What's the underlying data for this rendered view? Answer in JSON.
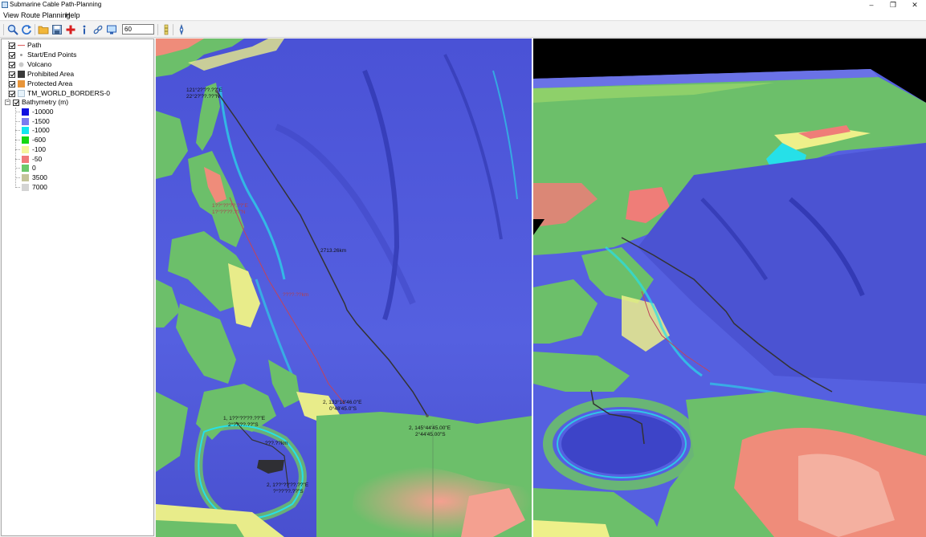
{
  "window": {
    "title": "Submarine Cable Path-Planning",
    "minimize_glyph": "–",
    "maximize_glyph": "❐",
    "close_glyph": "✕"
  },
  "menu": {
    "items": [
      "View",
      "Route Planning",
      "Help"
    ]
  },
  "toolbar": {
    "zoom_value": "60",
    "icons": [
      "zoom-icon",
      "refresh-icon",
      "open-folder-icon",
      "save-icon",
      "add-point-icon",
      "info-icon",
      "link-icon",
      "screen-icon",
      "scale-bar-icon",
      "compass-icon"
    ]
  },
  "layers": {
    "items": [
      {
        "label": "Path",
        "symbol": "line",
        "color": "#e06b6b"
      },
      {
        "label": "Start/End Points",
        "symbol": "dot",
        "color": "#9a9a9a"
      },
      {
        "label": "Volcano",
        "symbol": "circle",
        "color": "#b9b9b9"
      },
      {
        "label": "Prohibited Area",
        "symbol": "square",
        "color": "#3a3a3a"
      },
      {
        "label": "Protected Area",
        "symbol": "square",
        "color": "#e8953a"
      },
      {
        "label": "TM_WORLD_BORDERS-0",
        "symbol": "square",
        "color": "#e6f2fa"
      }
    ],
    "bathymetry": {
      "label": "Bathymetry (m)",
      "legend": [
        {
          "label": "-10000",
          "color": "#1010e0"
        },
        {
          "label": "-1500",
          "color": "#7b7bf0"
        },
        {
          "label": "-1000",
          "color": "#12e6ef"
        },
        {
          "label": "-600",
          "color": "#14d814"
        },
        {
          "label": "-100",
          "color": "#f5f59c"
        },
        {
          "label": "-50",
          "color": "#f07a7a"
        },
        {
          "label": "0",
          "color": "#6bc96b"
        },
        {
          "label": "3500",
          "color": "#c4c49b"
        },
        {
          "label": "7000",
          "color": "#d4d4d4"
        }
      ]
    }
  },
  "map2d": {
    "labels": [
      {
        "id": "start-1",
        "line1": "121°2?'??.??\"E",
        "line2": "22°2?'??.??\"N"
      },
      {
        "id": "start-2",
        "line1": "1??°??'??.??\"E",
        "line2": "1?°??'??.??\"N"
      },
      {
        "id": "dist-1",
        "line1": "2713.26km"
      },
      {
        "id": "dist-2",
        "line1": "????.??km"
      },
      {
        "id": "end-1",
        "line1": "2, 133°18'46.0\"E",
        "line2": "0°48'45.0\"S"
      },
      {
        "id": "end-2",
        "line1": "2, 145°44'45.00\"E",
        "line2": "2°44'45.00\"S"
      },
      {
        "id": "start-3",
        "line1": "1, 1??°??'??.??\"E",
        "line2": "2°??'??.??\"S"
      },
      {
        "id": "dist-3",
        "line1": "???.??km"
      },
      {
        "id": "end-3",
        "line1": "2, 1??°??'??.??\"E",
        "line2": "?°??'??.??\"S"
      }
    ]
  },
  "colors": {
    "deep": "#3d44c8",
    "ocean": "#5a63e6",
    "trench": "#2930a8",
    "shelf_cyan": "#26e0e8",
    "shallow_yellow": "#eef08a",
    "land_green": "#6cbf6a",
    "land_red": "#ef7d78",
    "land_bright": "#42d43a",
    "path_black": "#333333",
    "path_red": "#c0445c"
  }
}
